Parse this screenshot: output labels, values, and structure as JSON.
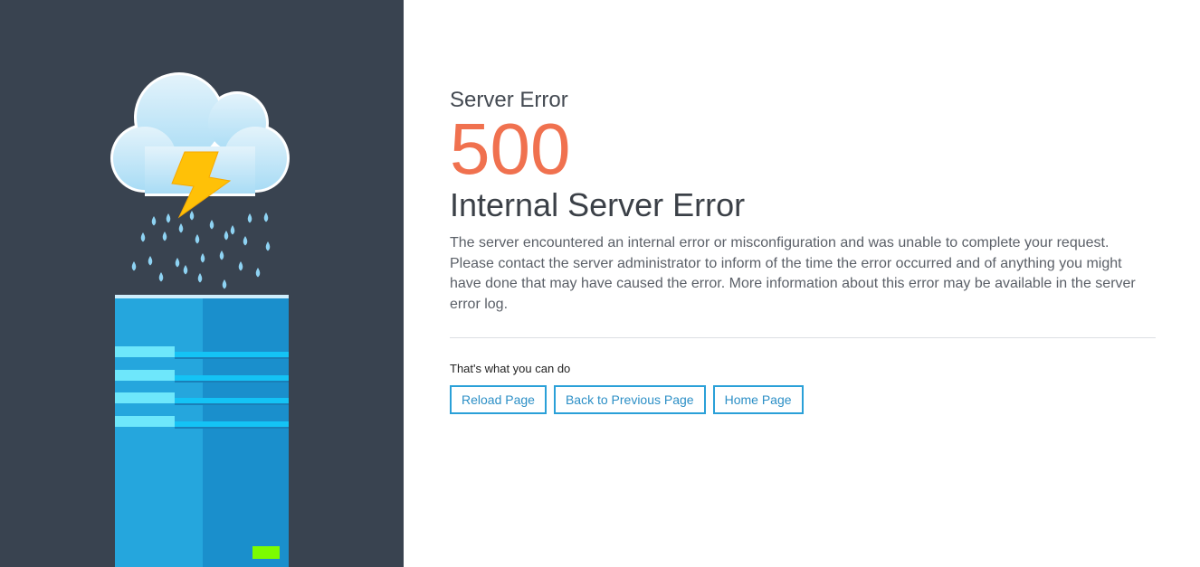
{
  "error": {
    "subtitle": "Server Error",
    "code": "500",
    "title": "Internal Server Error",
    "description": "The server encountered an internal error or misconfiguration and was unable to complete your request. Please contact the server administrator to inform of the time the error occurred and of anything you might have done that may have caused the error. More information about this error may be available in the server error log."
  },
  "actions": {
    "label": "That's what you can do",
    "buttons": [
      "Reload Page",
      "Back to Previous Page",
      "Home Page"
    ]
  },
  "colors": {
    "panel_background": "#394350",
    "error_code": "#f0714f",
    "button_border": "#2aa0d8",
    "server_light": "#7cfc00"
  },
  "icons": [
    "cloud-icon",
    "lightning-bolt-icon",
    "raindrop-icon",
    "server-tower-icon"
  ]
}
